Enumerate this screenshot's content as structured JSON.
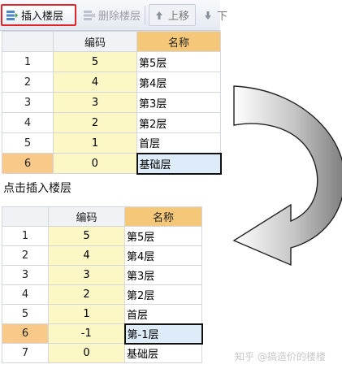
{
  "toolbar": {
    "insert_label": "插入楼层",
    "delete_label": "删除楼层",
    "up_label": "上移",
    "down_label": "下"
  },
  "table1": {
    "columns": [
      "",
      "编码",
      "名称"
    ],
    "rows": [
      {
        "index": "1",
        "code": "5",
        "name": "第5层"
      },
      {
        "index": "2",
        "code": "4",
        "name": "第4层"
      },
      {
        "index": "3",
        "code": "3",
        "name": "第3层"
      },
      {
        "index": "4",
        "code": "2",
        "name": "第2层"
      },
      {
        "index": "5",
        "code": "1",
        "name": "首层"
      },
      {
        "index": "6",
        "code": "0",
        "name": "基础层"
      }
    ]
  },
  "caption": "点击插入楼层",
  "table2": {
    "columns": [
      "",
      "编码",
      "名称"
    ],
    "rows": [
      {
        "index": "1",
        "code": "5",
        "name": "第5层"
      },
      {
        "index": "2",
        "code": "4",
        "name": "第4层"
      },
      {
        "index": "3",
        "code": "3",
        "name": "第3层"
      },
      {
        "index": "4",
        "code": "2",
        "name": "第2层"
      },
      {
        "index": "5",
        "code": "1",
        "name": "首层"
      },
      {
        "index": "6",
        "code": "-1",
        "name": "第-1层"
      },
      {
        "index": "7",
        "code": "0",
        "name": "基础层"
      }
    ]
  },
  "watermark": "知乎 @搞造价的楼楼",
  "icons": {
    "insert": "insert-floor-icon",
    "delete": "delete-floor-icon",
    "up": "arrow-up-icon",
    "down": "arrow-down-icon",
    "flow": "curved-arrow-icon"
  },
  "colors": {
    "highlight_border": "#e0262a",
    "code_column": "#fbf8c6",
    "name_header": "#f5c879",
    "selected_row_index": "#f9c98a",
    "selected_cell": "#ddecf8"
  }
}
